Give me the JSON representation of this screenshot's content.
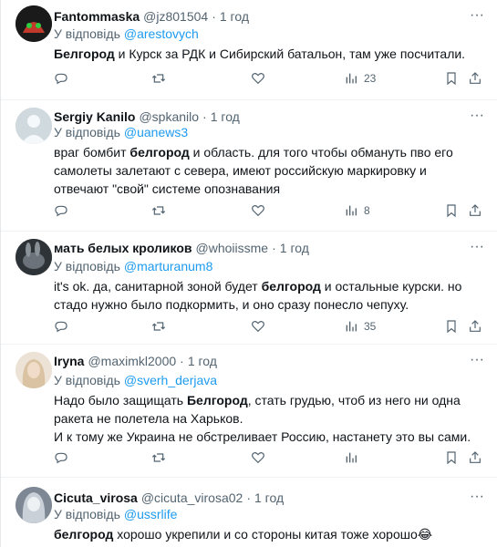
{
  "reply_prefix": "У відповідь",
  "more_glyph": "···",
  "emoji_laugh": "😂",
  "icons": [
    "more-icon",
    "reply-icon",
    "retweet-icon",
    "like-icon",
    "views-icon",
    "bookmark-icon",
    "share-icon"
  ],
  "colors": {
    "mention": "#1d9bf0",
    "secondary": "#536471",
    "text": "#0f1419",
    "divider": "#eff3f4"
  },
  "tweets": [
    {
      "name": "Fantommaska",
      "handle": "@jz801504",
      "time": "1 год",
      "reply_to": "@arestovych",
      "text": {
        "p1": {
          "bold1": "Белгород",
          "rest1": " и Курск за РДК и Сибирский батальон, там уже посчитали."
        }
      },
      "views": "23"
    },
    {
      "name": "Sergiy Kanilo",
      "handle": "@spkanilo",
      "time": "1 год",
      "reply_to": "@uanews3",
      "text": {
        "p1": {
          "pre1": "враг бомбит ",
          "bold1": "белгород",
          "rest1": " и область. для того чтобы обмануть пво его самолеты залетают с севера, имеют российскую маркировку и отвечают \"свой\" системе опознавания"
        }
      },
      "views": "8"
    },
    {
      "name": "мать белых кроликов",
      "handle": "@whoiissme",
      "time": "1 год",
      "reply_to": "@marturanum8",
      "text": {
        "p1": {
          "pre1": "it's ok. да, санитарной зоной будет ",
          "bold1": "белгород",
          "rest1": " и остальные курски. но стадо нужно было подкормить, и оно сразу понесло чепуху."
        }
      },
      "views": "35"
    },
    {
      "name": "Iryna",
      "handle": "@maximkl2000",
      "time": "1 год",
      "reply_to": "@sverh_derjava",
      "text": {
        "p1": {
          "pre1": "Надо было защищать ",
          "bold1": "Белгород",
          "rest1": ", стать грудью, чтоб из него ни одна ракета не полетела на Харьков."
        },
        "p2": "И к тому же Украина не обстреливает Россию, настанету это вы сами."
      }
    },
    {
      "name": "Cicuta_virosa",
      "handle": "@cicuta_virosa02",
      "time": "1 год",
      "reply_to": "@ussrlife",
      "text": {
        "p1": {
          "bold1": "белгород",
          "rest1": " хорошо укрепили и со стороны китая тоже хорошо"
        }
      }
    }
  ]
}
